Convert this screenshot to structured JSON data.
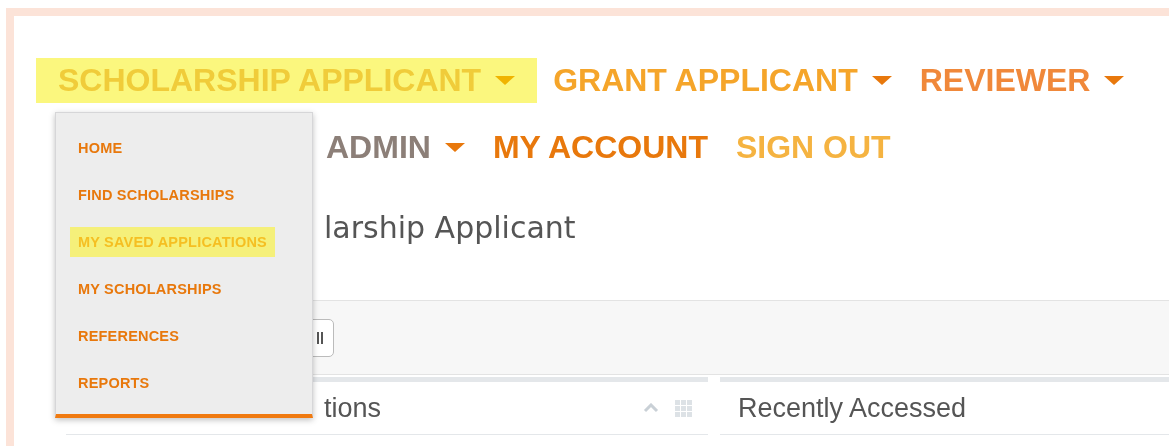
{
  "nav_row_1": [
    {
      "label": "SCHOLARSHIP APPLICANT",
      "kind": "menu",
      "selected": true
    },
    {
      "label": "GRANT APPLICANT",
      "kind": "menu",
      "selected": false,
      "color": "#f5a52a"
    },
    {
      "label": "REVIEWER",
      "kind": "menu",
      "selected": false,
      "color": "#f0883a"
    }
  ],
  "nav_row_2": [
    {
      "label": "ADMIN",
      "kind": "menu",
      "selected": false,
      "color": "#8c7f78"
    },
    {
      "label": "MY ACCOUNT",
      "kind": "link",
      "selected": false,
      "color": "#e8780c"
    },
    {
      "label": "SIGN OUT",
      "kind": "link",
      "selected": false,
      "color": "#f5b341"
    }
  ],
  "dropdown": {
    "items": [
      {
        "label": "HOME",
        "selected": false
      },
      {
        "label": "FIND SCHOLARSHIPS",
        "selected": false
      },
      {
        "label": "MY SAVED APPLICATIONS",
        "selected": true
      },
      {
        "label": "MY SCHOLARSHIPS",
        "selected": false
      },
      {
        "label": "REFERENCES",
        "selected": false
      },
      {
        "label": "REPORTS",
        "selected": false
      }
    ]
  },
  "page_heading": "larship Applicant",
  "panels": [
    {
      "title": "tions",
      "kind": "with-tools"
    },
    {
      "title": "Recently Accessed",
      "kind": "plain"
    }
  ]
}
